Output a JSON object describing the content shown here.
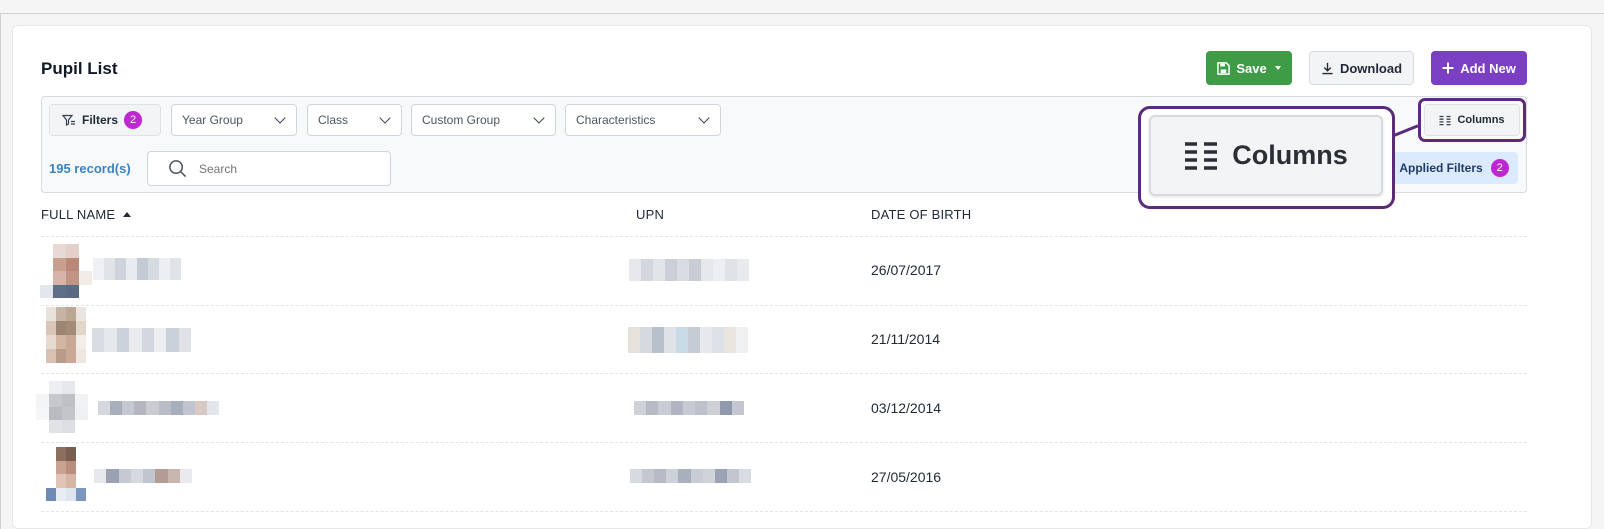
{
  "page": {
    "title": "Pupil List"
  },
  "toolbar": {
    "save_label": "Save",
    "download_label": "Download",
    "add_new_label": "Add New"
  },
  "filters": {
    "label": "Filters",
    "count": "2",
    "dropdowns": [
      {
        "label": "Year Group"
      },
      {
        "label": "Class"
      },
      {
        "label": "Custom Group"
      },
      {
        "label": "Characteristics"
      }
    ],
    "records": "195 record(s)",
    "search_placeholder": "Search",
    "columns_label": "Columns",
    "applied_label": "Applied Filters",
    "applied_count": "2"
  },
  "zoom_callout": {
    "label": "Columns"
  },
  "table": {
    "headers": [
      "FULL NAME",
      "UPN",
      "DATE OF BIRTH"
    ],
    "sort": "ascending",
    "rows": [
      {
        "dob": "26/07/2017"
      },
      {
        "dob": "21/11/2014"
      },
      {
        "dob": "03/12/2014"
      },
      {
        "dob": "27/05/2016"
      }
    ]
  },
  "colors": {
    "save": "#3f9b46",
    "add_new": "#7b3fc4",
    "badge": "#c026d3",
    "records": "#3b82c4",
    "highlight": "#5b2a7a",
    "applied_bg": "#dbeafe"
  }
}
